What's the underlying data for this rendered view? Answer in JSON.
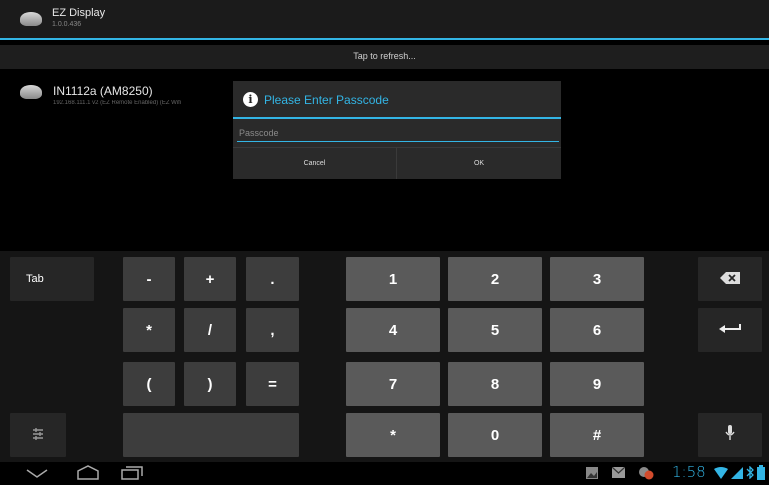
{
  "app": {
    "title": "EZ Display",
    "version": "1.0.0.436"
  },
  "refresh": {
    "label": "Tap to refresh..."
  },
  "device": {
    "name": "IN1112a (AM8250)",
    "info": "192.168.111.1 v2 (EZ Remote Enabled) (EZ Wifi"
  },
  "dialog": {
    "title": "Please Enter Passcode",
    "placeholder": "Passcode",
    "cancel": "Cancel",
    "ok": "OK"
  },
  "keyboard": {
    "tab": "Tab",
    "symbols": [
      "-",
      "+",
      ".",
      "*",
      "/",
      ",",
      "(",
      ")",
      "="
    ],
    "digits": [
      "1",
      "2",
      "3",
      "4",
      "5",
      "6",
      "7",
      "8",
      "9",
      "*",
      "0",
      "#"
    ]
  },
  "statusbar": {
    "time": "1:58"
  },
  "colors": {
    "accent": "#33b5e5",
    "key": "#3d3d3d",
    "digit_key": "#5a5a5a"
  }
}
